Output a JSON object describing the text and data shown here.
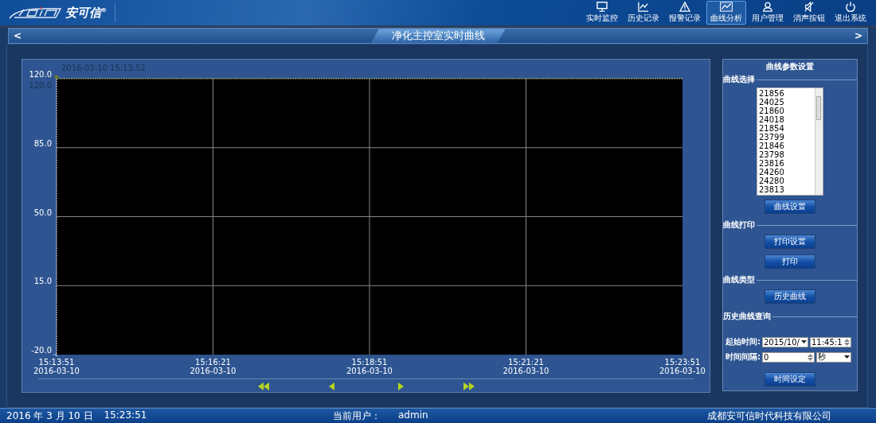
{
  "header": {
    "brand": "安可信$^{®}$",
    "nav": [
      {
        "label": "实时监控",
        "selected": false
      },
      {
        "label": "历史记录",
        "selected": false
      },
      {
        "label": "报警记录",
        "selected": false
      },
      {
        "label": "曲线分析",
        "selected": true
      },
      {
        "label": "用户管理",
        "selected": false
      },
      {
        "label": "消声按钮",
        "selected": false
      },
      {
        "label": "退出系统",
        "selected": false
      }
    ]
  },
  "title_bar": {
    "title": "净化主控室实时曲线",
    "prev": "<",
    "next": ">"
  },
  "chart": {
    "cursor_time": "2016-03-10 15:13:52",
    "cursor_value": "120.0",
    "chart_data": {
      "type": "line",
      "ylim": [
        -20,
        120
      ],
      "grid": true,
      "yticks": [
        {
          "value": 120,
          "label": "120.0"
        },
        {
          "value": 85,
          "label": "85.0"
        },
        {
          "value": 50,
          "label": "50.0"
        },
        {
          "value": 15,
          "label": "15.0"
        },
        {
          "value": -20,
          "label": "-20.0"
        }
      ],
      "categories": [
        "15:13:51\n2016-03-10",
        "15:16:21\n2016-03-10",
        "15:18:51\n2016-03-10",
        "15:21:21\n2016-03-10",
        "15:23:51\n2016-03-10"
      ]
    }
  },
  "settings": {
    "title": "曲线参数设置",
    "curve_select": {
      "heading": "曲线选择",
      "items": [
        {
          "label": "21856",
          "selected": false
        },
        {
          "label": "24025",
          "selected": false
        },
        {
          "label": "21860",
          "selected": false
        },
        {
          "label": "24018",
          "selected": false
        },
        {
          "label": "21854",
          "selected": false
        },
        {
          "label": "23799",
          "selected": false
        },
        {
          "label": "21846",
          "selected": false
        },
        {
          "label": "23798",
          "selected": false
        },
        {
          "label": "23816",
          "selected": false
        },
        {
          "label": "24260",
          "selected": false
        },
        {
          "label": "24280",
          "selected": false
        },
        {
          "label": "23813",
          "selected": false
        }
      ],
      "button": "曲线设置"
    },
    "print": {
      "heading": "曲线打印",
      "buttons": [
        "打印设置",
        "打印"
      ]
    },
    "type": {
      "heading": "曲线类型",
      "button": "历史曲线"
    },
    "query": {
      "heading": "历史曲线查询",
      "start_label": "起始时间:",
      "start_date": "2015/10/",
      "start_time": "11:45:1",
      "interval_label": "时间间隔:",
      "interval": "0",
      "unit": "秒",
      "button": "时间设定"
    }
  },
  "status_bar": {
    "date": "2016 年 3 月 10 日",
    "time": "15:23:51",
    "user_label": "当前用户：",
    "user": "admin",
    "company": "成都安可信时代科技有限公司"
  }
}
